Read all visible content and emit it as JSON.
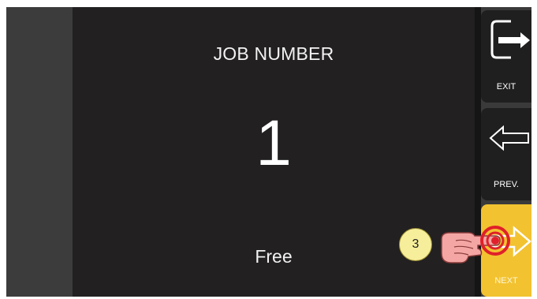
{
  "screen": {
    "heading": "JOB NUMBER",
    "value": "1",
    "status": "Free"
  },
  "buttons": {
    "exit_label": "EXIT",
    "prev_label": "PREV.",
    "next_label": "NEXT"
  },
  "annotation": {
    "step": "3"
  },
  "icons": {
    "exit": "exit-door-arrow-icon",
    "prev": "arrow-left-outline-icon",
    "next": "arrow-right-outline-icon",
    "pointer": "pointing-hand-icon"
  },
  "colors": {
    "panel": "#222021",
    "button": "#1f1f1f",
    "active_button": "#f2c230",
    "touch_ring": "#e0202a",
    "badge": "#f6ee9a"
  }
}
